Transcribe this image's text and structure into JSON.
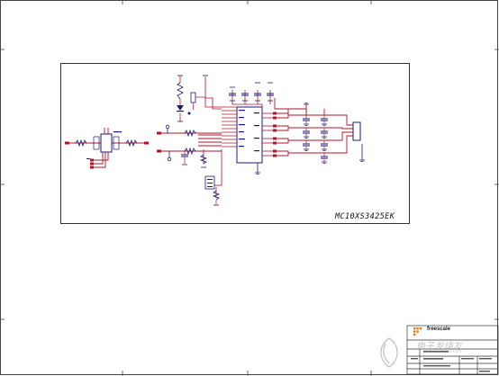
{
  "schematic": {
    "part_number": "MC10XS3425EK",
    "title_block": {
      "brand": "freescale"
    }
  },
  "watermark": {
    "text": "电子发烧友",
    "url": "www.elecfans.com"
  },
  "colors": {
    "wire": "#b0142a",
    "component": "#1a1a7a",
    "border": "#333333",
    "frame": "#444444",
    "watermark": "#9a9a9a"
  }
}
